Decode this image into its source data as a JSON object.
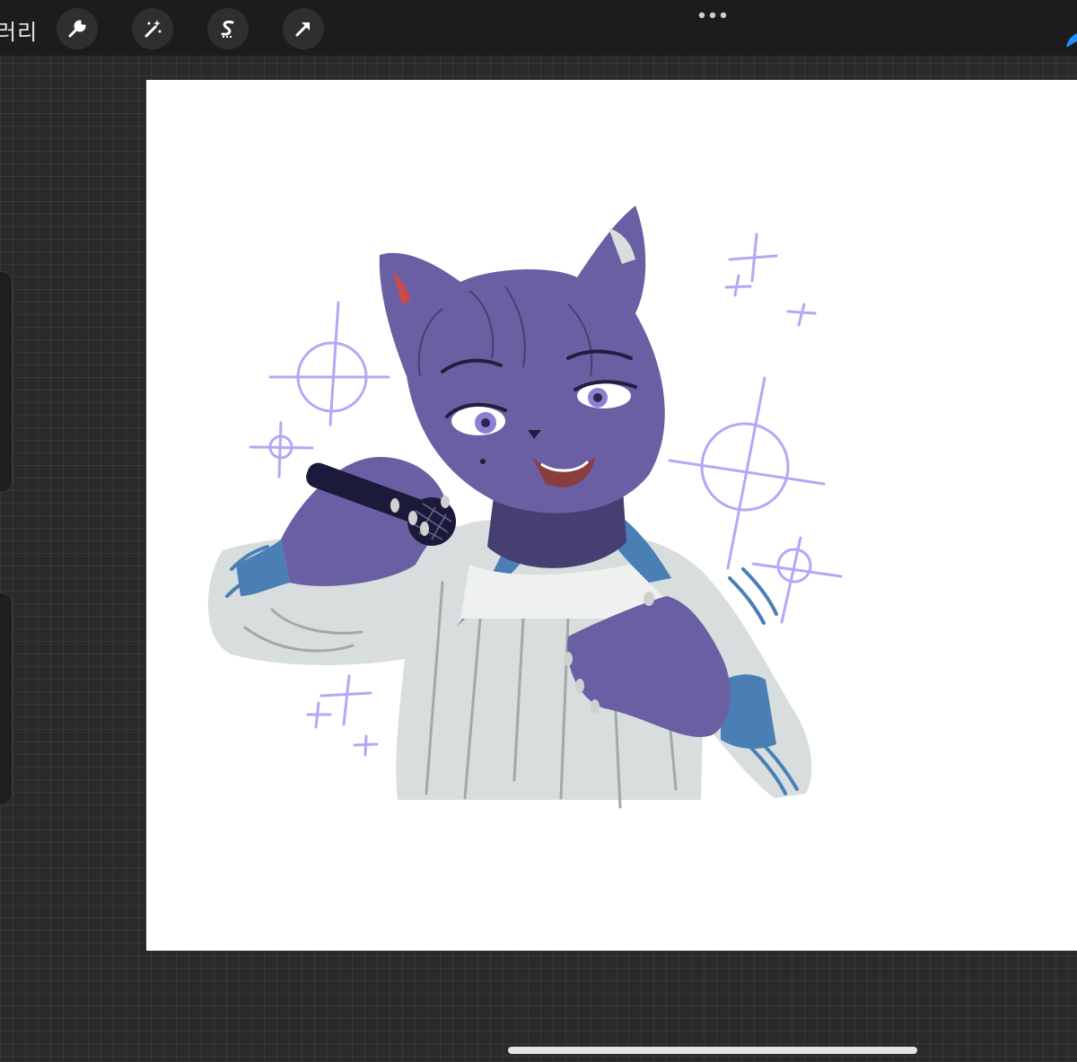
{
  "toolbar": {
    "gallery_label": "러리",
    "tools": [
      {
        "name": "wrench-icon"
      },
      {
        "name": "magic-wand-icon"
      },
      {
        "name": "selection-icon"
      },
      {
        "name": "transform-arrow-icon"
      }
    ],
    "more_icon": "more-dots-icon",
    "brush_icon": "brush-icon"
  },
  "colors": {
    "accent": "#1e90ff",
    "toolbar_bg": "#1c1c1e",
    "canvas_bg": "#ffffff",
    "fur": "#6b5fa3",
    "fur_shadow": "#463f72",
    "jacket": "#d8dedd",
    "jacket_lines": "#a2aaa8",
    "stripe": "#4a7fb5",
    "sparkle": "#b7a6f5"
  }
}
